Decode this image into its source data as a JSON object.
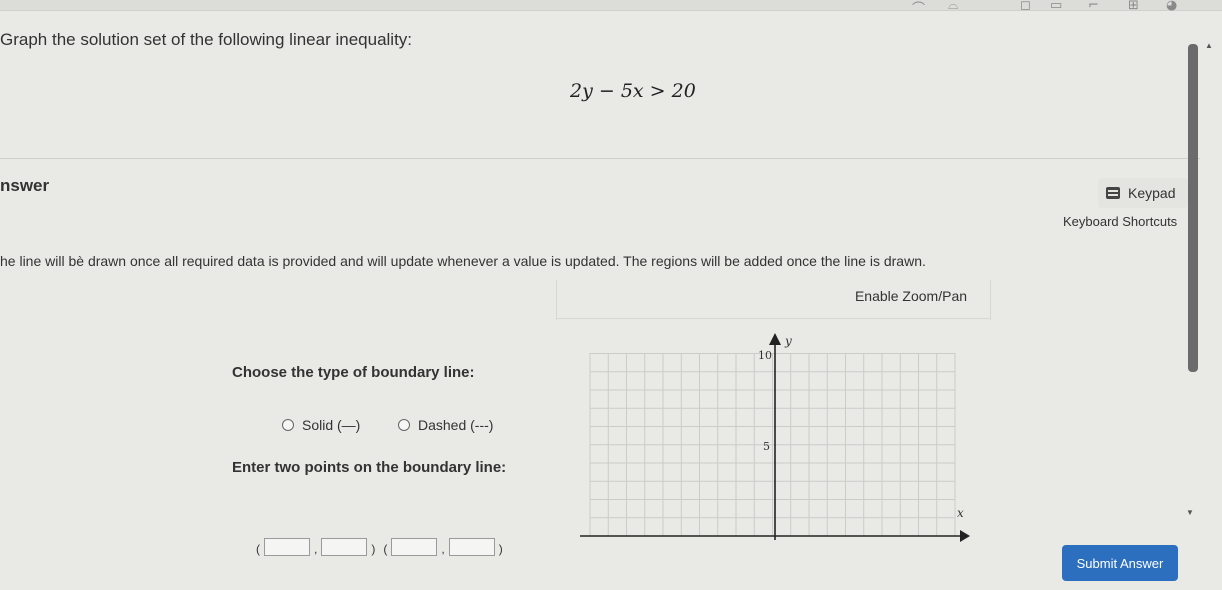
{
  "question": "Graph the solution set of the following linear inequality:",
  "inequality": "2y − 5x > 20",
  "answer_label": "nswer",
  "keypad_label": "Keypad",
  "shortcuts_label": "Keyboard Shortcuts",
  "info_text": "he line will bè drawn once all required data is provided and will update whenever a value is updated. The regions will be added once the line is drawn.",
  "zoom_label": "Enable Zoom/Pan",
  "boundary": {
    "title": "Choose the type of boundary line:",
    "options": [
      "Solid (—)",
      "Dashed (---)"
    ]
  },
  "points": {
    "title": "Enter two points on the boundary line:",
    "open": "(",
    "comma": ",",
    "close": ")",
    "values": [
      "",
      "",
      "",
      ""
    ]
  },
  "graph": {
    "y_axis_label": "y",
    "x_axis_label": "x",
    "y_tick_10": "10",
    "y_tick_5": "5"
  },
  "submit_label": "Submit Answer",
  "toolbar_icons": [
    "undo-icon",
    "redo-icon",
    "window-icon",
    "layout-icon",
    "pin-icon",
    "palette-icon"
  ],
  "colors": {
    "submit": "#2c6fbf",
    "background": "#e9e9e6"
  }
}
